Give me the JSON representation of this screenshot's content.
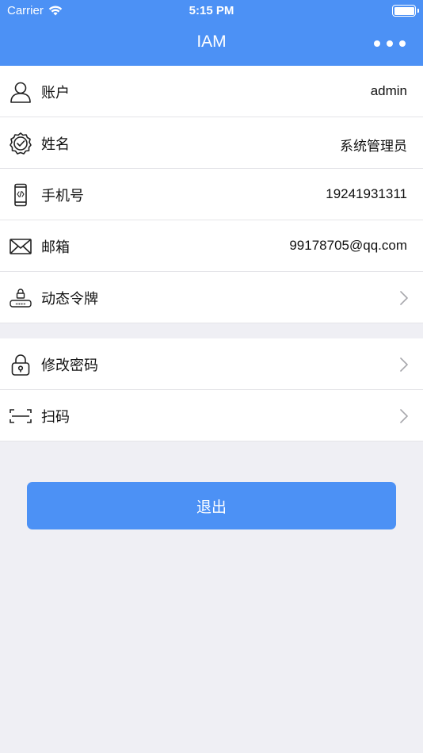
{
  "status_bar": {
    "carrier": "Carrier",
    "time": "5:15 PM"
  },
  "nav": {
    "title": "IAM",
    "more_icon": "more-horizontal-icon"
  },
  "profile": {
    "account": {
      "label": "账户",
      "value": "admin",
      "icon": "user-icon"
    },
    "name": {
      "label": "姓名",
      "value": "系统管理员",
      "icon": "verified-badge-icon"
    },
    "phone": {
      "label": "手机号",
      "value": "19241931311",
      "icon": "mobile-phone-icon"
    },
    "email": {
      "label": "邮箱",
      "value": "99178705@qq.com",
      "icon": "envelope-icon"
    },
    "token": {
      "label": "动态令牌",
      "icon": "password-lock-icon"
    }
  },
  "actions": {
    "change_password": {
      "label": "修改密码",
      "icon": "lock-icon"
    },
    "scan": {
      "label": "扫码",
      "icon": "scan-icon"
    }
  },
  "logout_label": "退出",
  "colors": {
    "primary": "#4c91f5",
    "background": "#efeff4"
  }
}
